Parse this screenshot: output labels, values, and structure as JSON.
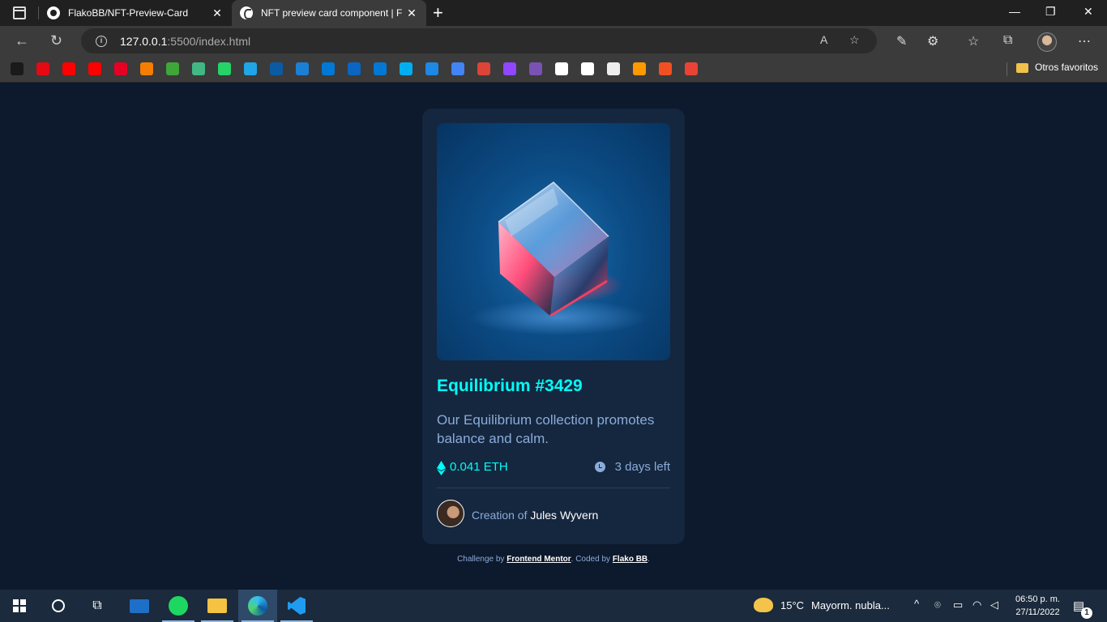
{
  "browser": {
    "tabs": [
      {
        "title": "FlakoBB/NFT-Preview-Card",
        "icon": "github-icon",
        "active": false
      },
      {
        "title": "NFT preview card component | Fr",
        "icon": "frontend-mentor-icon",
        "active": true
      }
    ],
    "new_tab_label": "+",
    "close_label": "✕",
    "window_controls": {
      "minimize": "—",
      "maximize": "❐",
      "close": "✕"
    },
    "address": {
      "host": "127.0.0.1",
      "path": ":5500/index.html"
    },
    "bookmarks": [
      {
        "name": "gf",
        "color": "#1a1a1a"
      },
      {
        "name": "netflix",
        "color": "#e50914"
      },
      {
        "name": "youtube",
        "color": "#ff0000"
      },
      {
        "name": "youtube-music",
        "color": "#ff0000"
      },
      {
        "name": "pinterest",
        "color": "#e60023"
      },
      {
        "name": "blogger",
        "color": "#f57d00"
      },
      {
        "name": "pixiv",
        "color": "#3fa63a"
      },
      {
        "name": "vue",
        "color": "#41b883"
      },
      {
        "name": "whatsapp",
        "color": "#25d366"
      },
      {
        "name": "messenger",
        "color": "#20a5e8"
      },
      {
        "name": "edge",
        "color": "#0c59a4"
      },
      {
        "name": "player",
        "color": "#1c7fd6"
      },
      {
        "name": "azure",
        "color": "#0078d4"
      },
      {
        "name": "linkedin",
        "color": "#0a66c2"
      },
      {
        "name": "outlook",
        "color": "#0078d4"
      },
      {
        "name": "skype",
        "color": "#00aff0"
      },
      {
        "name": "calendar",
        "color": "#1e88e5"
      },
      {
        "name": "translate",
        "color": "#4285f4"
      },
      {
        "name": "chrome",
        "color": "#db4437"
      },
      {
        "name": "twitch",
        "color": "#9146ff"
      },
      {
        "name": "bootstrap",
        "color": "#7952b3"
      },
      {
        "name": "amazon",
        "color": "#ffffff"
      },
      {
        "name": "github",
        "color": "#ffffff"
      },
      {
        "name": "notion",
        "color": "#eeeeee"
      },
      {
        "name": "onedrive",
        "color": "#ff9900"
      },
      {
        "name": "microsoft",
        "color": "#f25022"
      },
      {
        "name": "gmail",
        "color": "#ea4335"
      }
    ],
    "other_favorites": "Otros favoritos"
  },
  "card": {
    "title": "Equilibrium #3429",
    "description": "Our Equilibrium collection promotes balance and calm.",
    "price": "0.041 ETH",
    "time_left": "3 days left",
    "creator_prefix": "Creation of",
    "creator_name": "Jules Wyvern"
  },
  "attribution": {
    "prefix": "Challenge by",
    "link1": "Frontend Mentor",
    "middle": ". Coded by",
    "link2": "Flako BB",
    "suffix": "."
  },
  "taskbar": {
    "apps": [
      "windows-start",
      "cortana",
      "task-view",
      "mail",
      "spotify",
      "file-explorer",
      "edge",
      "vscode"
    ],
    "weather": {
      "temp": "15°C",
      "condition": "Mayorm. nubla..."
    },
    "time": "06:50 p. m.",
    "date": "27/11/2022",
    "notifications": "1"
  },
  "colors": {
    "page_bg": "#0d192c",
    "card_bg": "#15263f",
    "cyan": "#00fff8",
    "soft_blue": "#8bacd9"
  }
}
